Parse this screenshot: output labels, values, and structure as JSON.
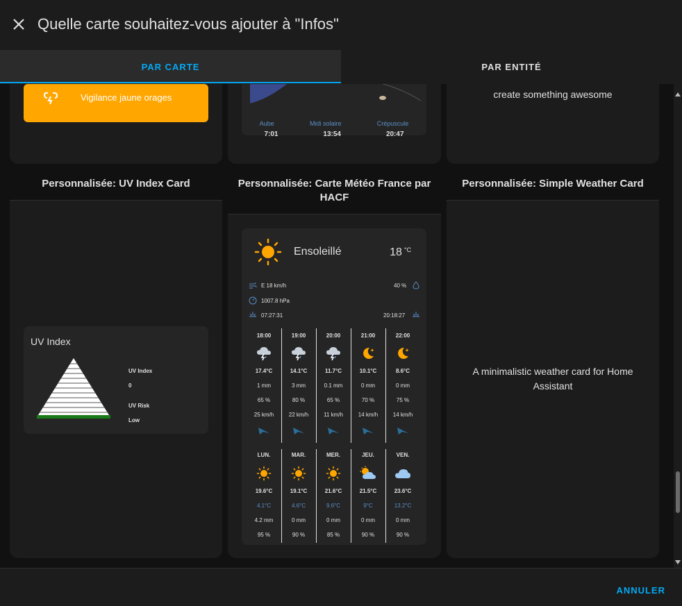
{
  "dialog": {
    "title": "Quelle carte souhaitez-vous ajouter à \"Infos\"",
    "close_icon": "close-icon"
  },
  "tabs": [
    {
      "label": "PAR CARTE",
      "active": true
    },
    {
      "label": "PAR ENTITÉ",
      "active": false
    }
  ],
  "top_row": {
    "alert_text": "Vigilance jaune orages",
    "sun": {
      "labels": [
        "Aube",
        "Midi solaire",
        "Crépuscule"
      ],
      "times": [
        "7:01",
        "13:54",
        "20:47"
      ]
    },
    "awesome_text": "create something awesome"
  },
  "cards": {
    "uv": {
      "title": "Personnalisée: UV Index Card",
      "heading": "UV Index",
      "index_label": "UV Index",
      "index_value": "0",
      "risk_label": "UV Risk",
      "risk_value": "Low"
    },
    "meteo": {
      "title": "Personnalisée: Carte Météo France par HACF",
      "condition": "Ensoleillé",
      "temperature": "18",
      "temperature_unit": "°C",
      "wind": "E 18 km/h",
      "humidity": "40 %",
      "pressure": "1007.8 hPa",
      "sunrise": "07:27:31",
      "sunset": "20:18:27",
      "hourly": [
        {
          "time": "18:00",
          "icon": "lightning-rainy-icon",
          "temp": "17.4°C",
          "rain": "1 mm",
          "prob": "65 %",
          "wind": "25 km/h"
        },
        {
          "time": "19:00",
          "icon": "lightning-rainy-icon",
          "temp": "14.1°C",
          "rain": "3 mm",
          "prob": "80 %",
          "wind": "22 km/h"
        },
        {
          "time": "20:00",
          "icon": "lightning-rainy-icon",
          "temp": "11.7°C",
          "rain": "0.1 mm",
          "prob": "65 %",
          "wind": "11 km/h"
        },
        {
          "time": "21:00",
          "icon": "night-icon",
          "temp": "10.1°C",
          "rain": "0 mm",
          "prob": "70 %",
          "wind": "14 km/h"
        },
        {
          "time": "22:00",
          "icon": "night-icon",
          "temp": "8.6°C",
          "rain": "0 mm",
          "prob": "75 %",
          "wind": "14 km/h"
        }
      ],
      "daily": [
        {
          "day": "LUN.",
          "icon": "sunny-icon",
          "high": "19.6°C",
          "low": "4.1°C",
          "rain": "4.2 mm",
          "prob": "95 %"
        },
        {
          "day": "MAR.",
          "icon": "sunny-icon",
          "high": "19.1°C",
          "low": "4.6°C",
          "rain": "0 mm",
          "prob": "90 %"
        },
        {
          "day": "MER.",
          "icon": "sunny-icon",
          "high": "21.6°C",
          "low": "9.6°C",
          "rain": "0 mm",
          "prob": "85 %"
        },
        {
          "day": "JEU.",
          "icon": "partly-cloudy-icon",
          "high": "21.5°C",
          "low": "9°C",
          "rain": "0 mm",
          "prob": "90 %"
        },
        {
          "day": "VEN.",
          "icon": "cloudy-icon",
          "high": "23.6°C",
          "low": "13.2°C",
          "rain": "0 mm",
          "prob": "90 %"
        }
      ]
    },
    "simple": {
      "title": "Personnalisée: Simple Weather Card",
      "description": "A minimalistic weather card for Home Assistant"
    }
  },
  "footer": {
    "cancel_label": "ANNULER"
  },
  "colors": {
    "accent": "#03a9f4",
    "alert": "#ffa600",
    "sun": "#ffa600",
    "low_temp": "#5b8fc7"
  }
}
